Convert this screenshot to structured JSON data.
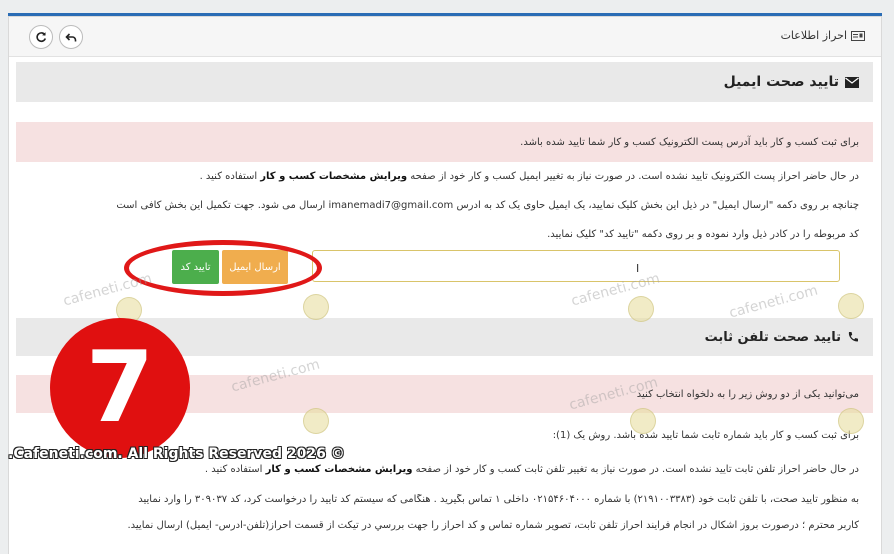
{
  "header": {
    "title": "احراز اطلاعات",
    "refresh_icon": "refresh-icon",
    "back_icon": "undo-arrow-icon",
    "id_card_icon": "id-card-icon"
  },
  "email_section": {
    "title": "تایید صحت ایمیل",
    "icon": "envelope-icon",
    "alert": "برای ثبت کسب و کار باید آدرس پست الکترونیک کسب و کار شما تایید شده باشد.",
    "line1_pre": "در حال حاضر احراز پست الکترونیک تایید نشده است. در صورت نیاز به تغییر ایمیل کسب و کار خود از صفحه ",
    "line1_bold": "ویرایش مشخصات کسب و کار",
    "line1_post": " استفاده کنید .",
    "line2_pre": "چنانچه بر روی دکمه \"ارسال ایمیل\" در ذیل این بخش کلیک نمایید، یک ایمیل حاوی یک کد به آدرس ",
    "line2_email": "imanemadi7@gmail.com",
    "line2_post": " ارسال می شود. جهت تکمیل این بخش کافی است",
    "line3": "کد مربوطه را در کادر ذیل وارد نموده و بر روی دکمه \"تایید کد\" کلیک نمایید.",
    "send_email_label": "ارسال ایمیل",
    "verify_code_label": "تایید کد",
    "code_input_value": ""
  },
  "phone_section": {
    "title": "تایید صحت تلفن ثابت",
    "icon": "phone-icon",
    "alert": "می‌توانید یکی از دو روش زیر را به دلخواه انتخاب کنید",
    "method1": "برای ثبت کسب و کار باید شماره ثابت شما تایید شده باشد. روش یک (1):",
    "line1_pre": "در حال حاضر احراز تلفن ثابت تایید نشده است. در صورت نیاز به تغییر تلفن ثابت کسب و کار خود از صفحه ",
    "line1_bold": "ویرایش مشخصات کسب و کار",
    "line1_post": " استفاده کنید .",
    "line2": "به منظور تایید صحت، با تلفن ثابت خود (۲۱۹۱۰۰۳۳۸۳) با شماره ۰۲۱۵۴۶۰۴۰۰۰ داخلی ۱ تماس بگیرید . هنگامی که سیستم کد تایید را درخواست کرد، کد ۳۰۹۰۳۷ را وارد نمایید",
    "line3": "کاربر محترم ؛ درصورت بروز اشکال در انجام فرآیند احراز تلفن ثابت، تصویر شماره تماس و کد احراز را جهت بررسي در تیکت از قسمت احراز(تلفن-آدرس- ایمیل) ارسال نمایید."
  },
  "overlay": {
    "badge_number": "7",
    "copyright": ".Cafeneti.com. All Rights Reserved 2026 ©",
    "watermark": "cafeneti.com"
  },
  "colors": {
    "send_email_button": "#f0ad4e",
    "verify_code_button": "#4cae4c",
    "alert_bg": "#f6e1e1",
    "highlight_circle": "#e01818",
    "top_accent": "#2a6cb5"
  }
}
